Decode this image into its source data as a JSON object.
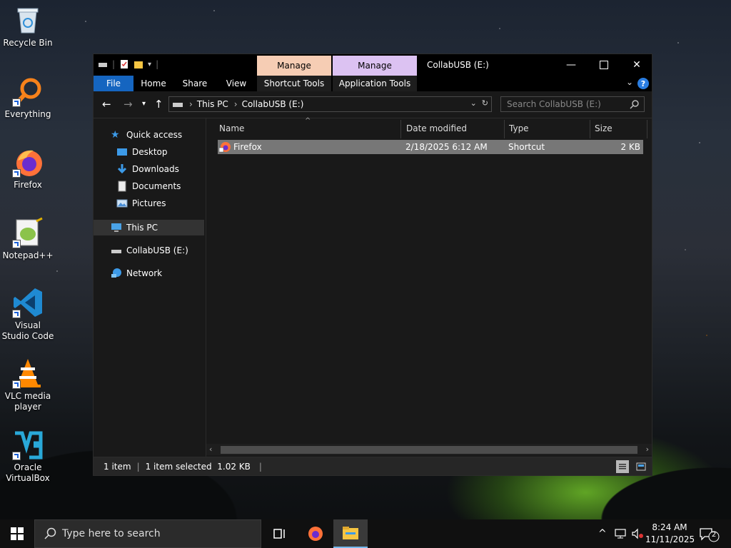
{
  "desktop": {
    "icons": [
      {
        "label": "Recycle Bin",
        "icon": "recycle-bin-icon"
      },
      {
        "label": "Everything",
        "icon": "everything-search-icon"
      },
      {
        "label": "Firefox",
        "icon": "firefox-icon"
      },
      {
        "label": "Notepad++",
        "icon": "notepad-plus-plus-icon"
      },
      {
        "label": "Visual Studio Code",
        "icon": "vscode-icon"
      },
      {
        "label": "VLC media player",
        "icon": "vlc-icon"
      },
      {
        "label": "Oracle VirtualBox",
        "icon": "virtualbox-icon"
      }
    ]
  },
  "window": {
    "title": "CollabUSB (E:)",
    "context_tabs": [
      {
        "group": "Manage",
        "tab": "Shortcut Tools",
        "color": "#f6cdb4"
      },
      {
        "group": "Manage",
        "tab": "Application Tools",
        "color": "#dcc2f2"
      }
    ],
    "ribbon_tabs": [
      "File",
      "Home",
      "Share",
      "View"
    ],
    "help_label": "?"
  },
  "address": {
    "segments": [
      "This PC",
      "CollabUSB (E:)"
    ]
  },
  "search": {
    "placeholder": "Search CollabUSB (E:)"
  },
  "nav_pane": {
    "quick_access": "Quick access",
    "quick_items": [
      "Desktop",
      "Downloads",
      "Documents",
      "Pictures"
    ],
    "this_pc": "This PC",
    "drive": "CollabUSB (E:)",
    "network": "Network"
  },
  "columns": [
    "Name",
    "Date modified",
    "Type",
    "Size"
  ],
  "files": [
    {
      "name": "Firefox",
      "date": "2/18/2025 6:12 AM",
      "type": "Shortcut",
      "size": "2 KB"
    }
  ],
  "status": {
    "count": "1 item",
    "selected": "1 item selected  1.02 KB"
  },
  "taskbar": {
    "search_placeholder": "Type here to search",
    "time": "8:24 AM",
    "date": "11/11/2025",
    "notification_count": "2"
  },
  "colors": {
    "accent": "#1565c0",
    "selection": "#777777"
  }
}
